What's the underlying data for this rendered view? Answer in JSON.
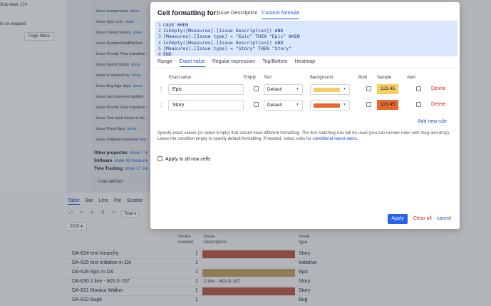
{
  "left": {
    "badge": "Sub-task",
    "badge_count": "234",
    "expand": "to or expand",
    "page_filters": "Page filters"
  },
  "measure_list": [
    {
      "label": "Issue components",
      "link": "show"
    },
    {
      "label": "Issue Epic Link",
      "link": "show"
    },
    {
      "label": "Issue Linked Issues",
      "link": "show"
    },
    {
      "label": "Issue NumberFieldBtaTest",
      "link": ""
    },
    {
      "label": "Issue Priority Flow transition",
      "link": ""
    },
    {
      "label": "Issue Sprint Status",
      "link": "show"
    },
    {
      "label": "Issue is blocked by",
      "link": "show"
    },
    {
      "label": "Issue Bug Age days",
      "link": "show"
    },
    {
      "label": "Issue last comment splitted",
      "link": ""
    },
    {
      "label": "Issue Priority Flow transition",
      "link": ""
    },
    {
      "label": "Issue Test work hours in sta",
      "link": ""
    },
    {
      "label": "Issue Plans Epic",
      "link": "show"
    },
    {
      "label": "Issue Original estimated hou",
      "link": ""
    }
  ],
  "categories": [
    {
      "label": "Other properties",
      "link": "show 7 m"
    },
    {
      "label": "Software",
      "link": "show 42 measure"
    },
    {
      "label": "Time Tracking",
      "link": "show 17 me"
    }
  ],
  "user_defined": "User defined",
  "viz_tabs": [
    "Table",
    "Bar",
    "Line",
    "Pie",
    "Scatter"
  ],
  "total_label": "Total",
  "year": "2025",
  "table": {
    "headers": {
      "issues_created": "Issues created",
      "issue_description": "Issue Description",
      "issue_type": "Issue type"
    },
    "rows": [
      {
        "name": "DA-624 test hiearchy",
        "count": "1",
        "desc": "",
        "type": "Story",
        "color": "#b8594a"
      },
      {
        "name": "DA-625 test initiative in DA",
        "count": "1",
        "desc": "",
        "type": "Initiative",
        "color": ""
      },
      {
        "name": "DA-626 Epic in DA",
        "count": "1",
        "desc": "",
        "type": "Epic",
        "color": "#c2a264"
      },
      {
        "name": "DA-630 2.line - M2LS-157",
        "count": "1",
        "desc": "2.line - M2LS-157",
        "type": "Story",
        "color": ""
      },
      {
        "name": "DA-631 Monica Walker",
        "count": "1",
        "desc": "",
        "type": "Story",
        "color": "#b8594a"
      },
      {
        "name": "DA-632 Bug6",
        "count": "1",
        "desc": "",
        "type": "Bug",
        "color": ""
      }
    ]
  },
  "dialog": {
    "title": "Cell formatting for:",
    "tabs": [
      "Issue Description",
      "Custom formula"
    ],
    "active_tab": 1,
    "code": [
      "CASE WHEN",
      "IsEmpty([Measures].[Issue Description]) AND",
      "[Measures].[Issue type] = \"Epic\" THEN \"Epic\" WHEN",
      "IsEmpty([Measures].[Issue Description]) AND",
      "[Measures].[Issue type] = \"Story\" THEN \"Story\"",
      "END"
    ],
    "subtabs": [
      "Range",
      "Exact value",
      "Regular expression",
      "Top/Bottom",
      "Heatmap"
    ],
    "active_subtab": 1,
    "columns": {
      "exact_value": "Exact value",
      "empty": "Empty",
      "text": "Text",
      "background": "Background",
      "bold": "Bold",
      "sample": "Sample",
      "alert": "Alert"
    },
    "rules": [
      {
        "value": "Epic",
        "text": "Default",
        "bg_color": "#f7cd62",
        "sample": "123.45",
        "delete": "Delete"
      },
      {
        "value": "Story",
        "text": "Default",
        "bg_color": "#e8692f",
        "sample": "123.45",
        "delete": "Delete"
      }
    ],
    "add_rule": "Add new rule",
    "help_text": "Specify exact values (or select Empty) that should have different formatting. The first matching rule will be used (you can reorder rules with drag-and-drop). Leave the condition empty to specify default formatting. If needed, select rules for",
    "help_link": "conditional report alerts.",
    "apply_all": "Apply to all row cells",
    "apply_btn": "Apply",
    "clear_btn": "Clear all",
    "cancel_btn": "cancel"
  }
}
